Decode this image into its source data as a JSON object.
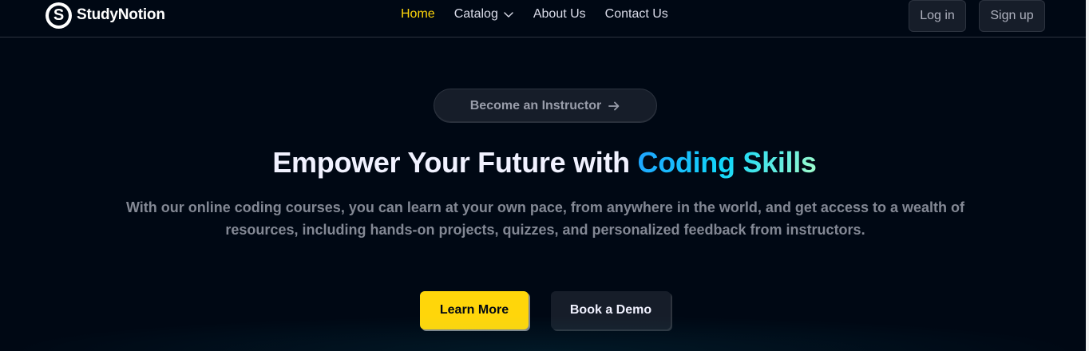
{
  "brand": {
    "name": "StudyNotion",
    "mark": "S"
  },
  "nav": {
    "links": [
      {
        "label": "Home",
        "active": true
      },
      {
        "label": "Catalog",
        "dropdown": true
      },
      {
        "label": "About Us"
      },
      {
        "label": "Contact Us"
      }
    ],
    "login_label": "Log in",
    "signup_label": "Sign up"
  },
  "hero": {
    "instructor_label": "Become an Instructor",
    "title_prefix": "Empower Your Future with ",
    "title_highlight": "Coding Skills",
    "subtitle": "With our online coding courses, you can learn at your own pace, from anywhere in the world, and get access to a wealth of resources, including hands-on projects, quizzes, and personalized feedback from instructors.",
    "primary_cta": "Learn More",
    "secondary_cta": "Book a Demo"
  },
  "colors": {
    "background": "#000814",
    "accent_yellow": "#ffd60a",
    "gradient": [
      "#1fa2ff",
      "#12d8fa",
      "#a6ffcb"
    ]
  },
  "icons": {
    "logo": "studynotion-logo-icon",
    "catalog": "chevron-down-icon",
    "instructor": "arrow-right-icon"
  }
}
